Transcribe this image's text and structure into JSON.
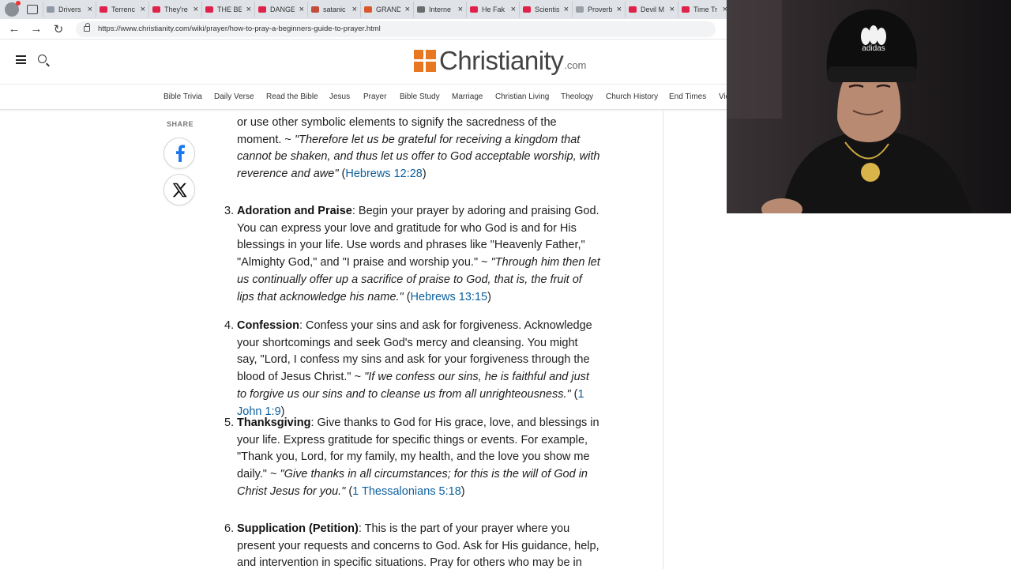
{
  "browser": {
    "tabs": [
      {
        "title": "Drivers",
        "fav": "#8f9aa6"
      },
      {
        "title": "Terrenc",
        "fav": "#e0224b"
      },
      {
        "title": "They're",
        "fav": "#e0224b"
      },
      {
        "title": "THE BE",
        "fav": "#e0224b"
      },
      {
        "title": "DANGE",
        "fav": "#e0224b"
      },
      {
        "title": "satanic",
        "fav": "#c44c3a"
      },
      {
        "title": "GRAND",
        "fav": "#d8582c"
      },
      {
        "title": "Interne",
        "fav": "#6b6b6b"
      },
      {
        "title": "He Fak",
        "fav": "#e0224b"
      },
      {
        "title": "Scientis",
        "fav": "#e0224b"
      },
      {
        "title": "Proverb",
        "fav": "#9aa0a6"
      },
      {
        "title": "Devil M",
        "fav": "#e0224b"
      },
      {
        "title": "Time Tr",
        "fav": "#e0224b"
      }
    ],
    "close_glyph": "×",
    "url": "https://www.christianity.com/wiki/prayer/how-to-pray-a-beginners-guide-to-prayer.html",
    "back_glyph": "←",
    "forward_glyph": "→",
    "reload_glyph": "↻"
  },
  "site": {
    "logo_word": "Christianity",
    "logo_tld": ".com",
    "brand_color": "#e87722",
    "nav": [
      "Bible Trivia",
      "Daily Verse",
      "Read the Bible",
      "Jesus",
      "Prayer",
      "Bible Study",
      "Marriage",
      "Christian Living",
      "Theology",
      "Church History",
      "End Times",
      "Vid"
    ]
  },
  "share": {
    "label": "SHARE",
    "facebook_glyph": "f",
    "x_glyph": "X"
  },
  "article": {
    "item2_tail": {
      "text": "or use other symbolic elements to signify the sacredness of the moment. ~ ",
      "quote": "\"Therefore let us be grateful for receiving a kingdom that cannot be shaken, and thus let us offer to God acceptable worship, with reverence and awe\"",
      "ref": "Hebrews 12:28"
    },
    "items": [
      {
        "num": "3.",
        "title": "Adoration and Praise",
        "text": ": Begin your prayer by adoring and praising God. You can express your love and gratitude for who God is and for His blessings in your life. Use words and phrases like \"Heavenly Father,\" \"Almighty God,\" and \"I praise and worship you.\" ~ ",
        "quote": "\"Through him then let us continually offer up a sacrifice of praise to God, that is, the fruit of lips that acknowledge his name.\"",
        "ref": "Hebrews 13:15"
      },
      {
        "num": "4.",
        "title": "Confession",
        "text": ": Confess your sins and ask for forgiveness. Acknowledge your shortcomings and seek God's mercy and cleansing. You might say, \"Lord, I confess my sins and ask for your forgiveness through the blood of Jesus Christ.\" ~ ",
        "quote": "\"If we confess our sins, he is faithful and just to forgive us our sins and to cleanse us from all unrighteousness.\"",
        "ref": "1 John 1:9"
      },
      {
        "num": "5.",
        "title": "Thanksgiving",
        "text": ": Give thanks to God for His grace, love, and blessings in your life. Express gratitude for specific things or events. For example, \"Thank you, Lord, for my family, my health, and the love you show me daily.\" ~ ",
        "quote": "\"Give thanks in all circumstances; for this is the will of God in Christ Jesus for you.\"",
        "ref": "1 Thessalonians 5:18"
      },
      {
        "num": "6.",
        "title": "Supplication (Petition)",
        "text": ": This is the part of your prayer where you present your requests and concerns to God. Ask for His guidance, help, and intervention in specific situations. Pray for others who may be in need"
      }
    ]
  },
  "webcam": {
    "hat_brand": "adidas"
  }
}
